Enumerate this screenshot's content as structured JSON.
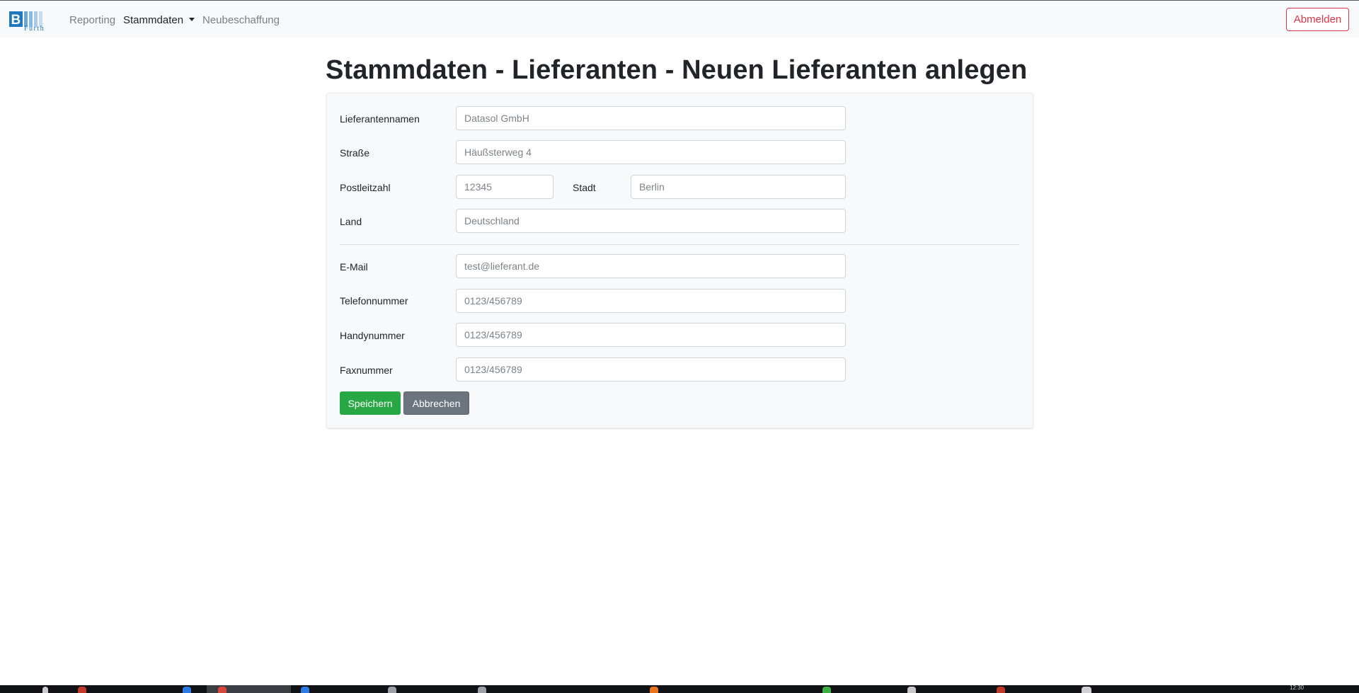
{
  "navbar": {
    "logo": {
      "letter": "B",
      "text": "Furth",
      "accent": "#1f78bd"
    },
    "links": [
      {
        "label": "Reporting"
      },
      {
        "label": "Stammdaten",
        "dropdown": true
      },
      {
        "label": "Neubeschaffung"
      }
    ],
    "logout_label": "Abmelden"
  },
  "page": {
    "title": "Stammdaten - Lieferanten - Neuen Lieferanten anlegen"
  },
  "form": {
    "name": {
      "label": "Lieferantennamen",
      "placeholder": "Datasol GmbH"
    },
    "street": {
      "label": "Straße",
      "placeholder": "Häußsterweg 4"
    },
    "zip": {
      "label": "Postleitzahl",
      "placeholder": "12345"
    },
    "city": {
      "label": "Stadt",
      "placeholder": "Berlin"
    },
    "country": {
      "label": "Land",
      "placeholder": "Deutschland"
    },
    "email": {
      "label": "E-Mail",
      "placeholder": "test@lieferant.de"
    },
    "phone": {
      "label": "Telefonnummer",
      "placeholder": "0123/456789"
    },
    "mobile": {
      "label": "Handynummer",
      "placeholder": "0123/456789"
    },
    "fax": {
      "label": "Faxnummer",
      "placeholder": "0123/456789"
    },
    "save_label": "Speichern",
    "cancel_label": "Abbrechen"
  },
  "colors": {
    "save": "#28a745",
    "cancel": "#6c757d",
    "logout": "#dc3545",
    "navbar_bg": "#f8f9fa"
  },
  "taskbar": {
    "clock": "12:30"
  }
}
